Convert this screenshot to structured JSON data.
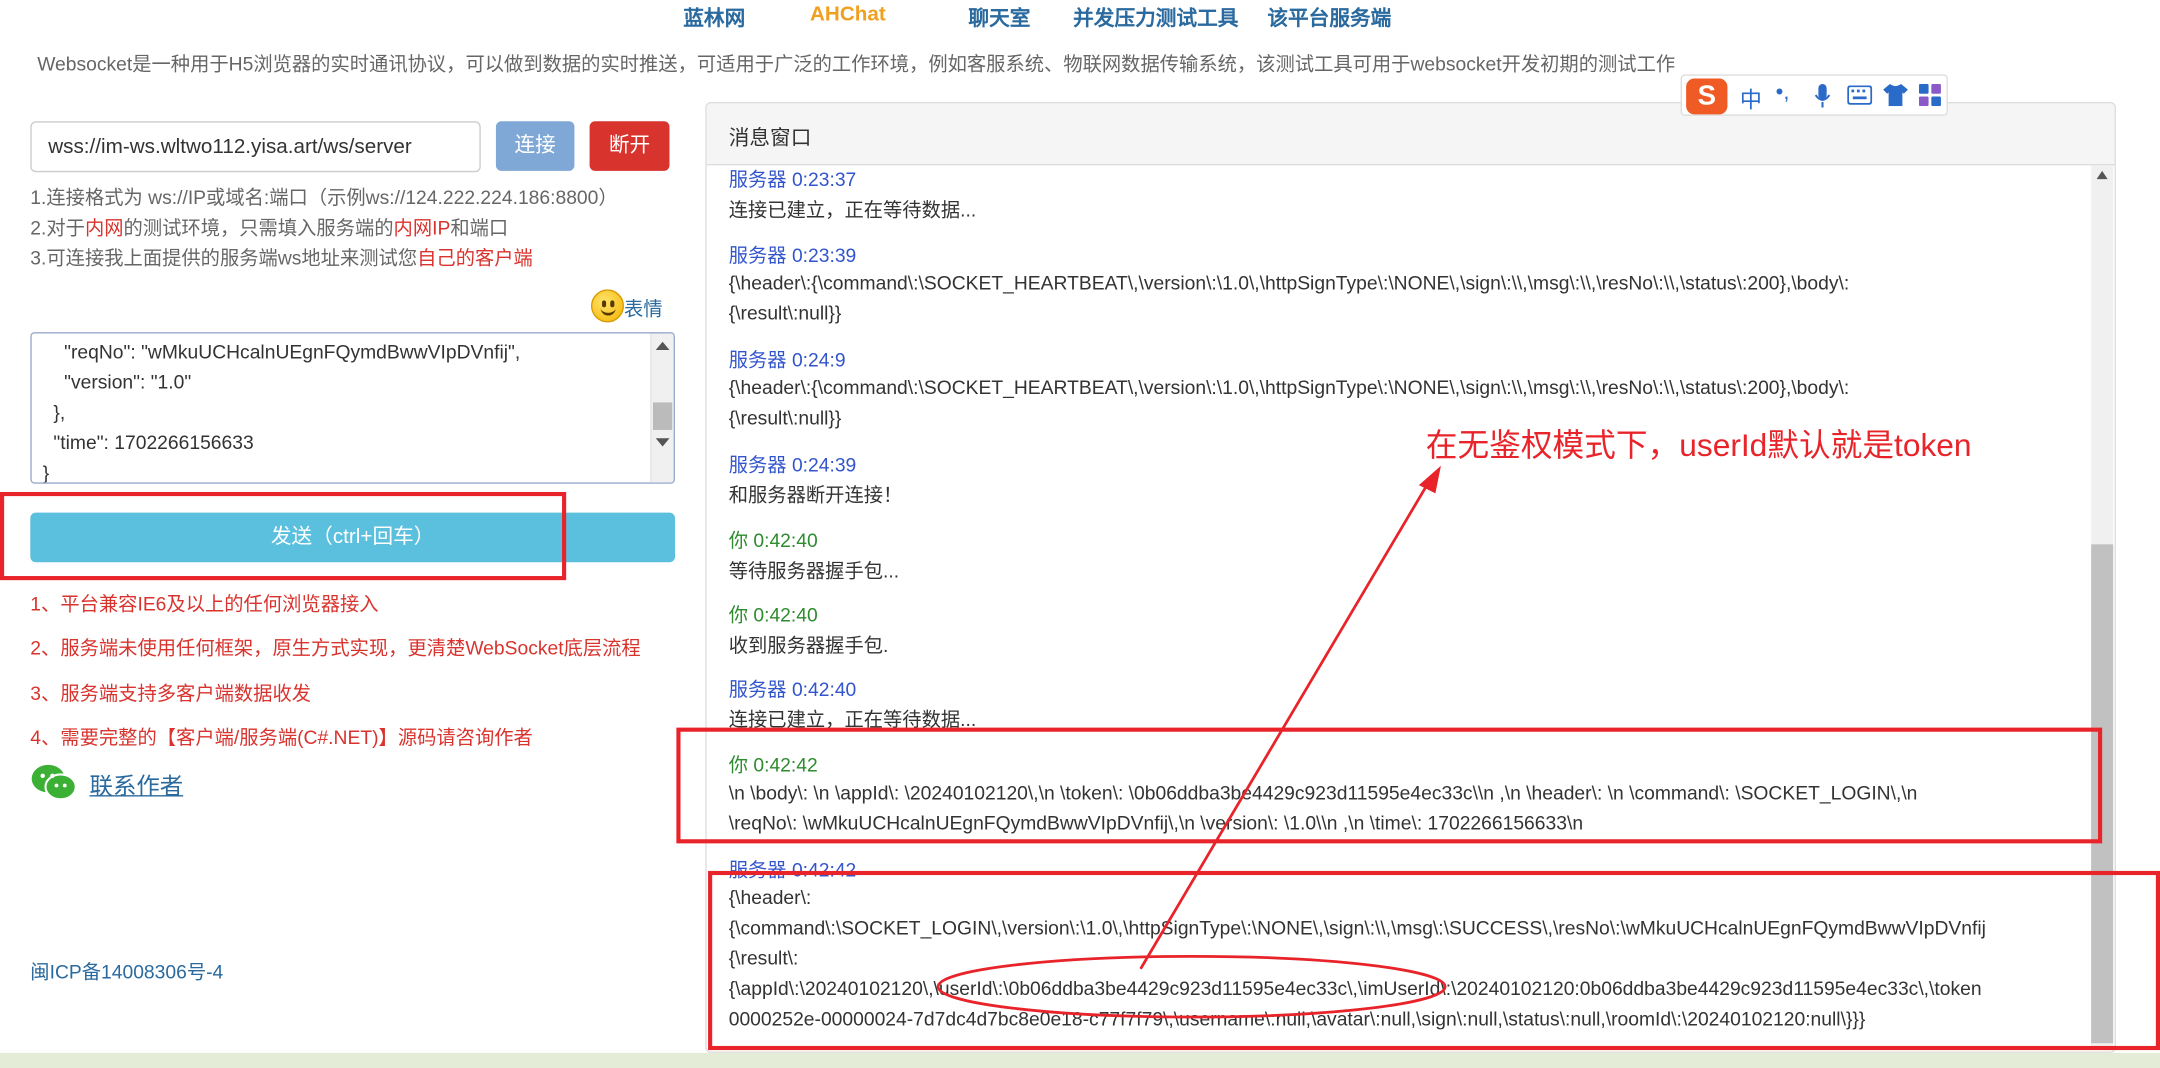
{
  "nav": {
    "items": [
      "蓝林网",
      "AHChat",
      "聊天室",
      "并发压力测试工具",
      "该平台服务端"
    ]
  },
  "description": "Websocket是一种用于H5浏览器的实时通讯协议，可以做到数据的实时推送，可适用于广泛的工作环境，例如客服系统、物联网数据传输系统，该测试工具可用于websocket开发初期的测试工作",
  "connection": {
    "url_value": "wss://im-ws.wltwo112.yisa.art/ws/server",
    "connect_label": "连接",
    "disconnect_label": "断开"
  },
  "notes": {
    "line1": "1.连接格式为 ws://IP或域名:端口（示例ws://124.222.224.186:8800）",
    "line2_pre": "2.对于",
    "line2_red1": "内网",
    "line2_mid": "的测试环境，只需填入服务端的",
    "line2_red2": "内网IP",
    "line2_post": "和端口",
    "line3_pre": "3.可连接我上面提供的服务端ws地址来测试您",
    "line3_red": "自己的客户端"
  },
  "emoji_label": "表情",
  "textarea": {
    "lines": [
      "    \"reqNo\": \"wMkuUCHcalnUEgnFQymdBwwVIpDVnfij\",",
      "    \"version\": \"1.0\"",
      "  },",
      "  \"time\": 1702266156633",
      "}"
    ]
  },
  "send_label": "发送（ctrl+回车）",
  "features": [
    "1、平台兼容IE6及以上的任何浏览器接入",
    "2、服务端未使用任何框架，原生方式实现，更清楚WebSocket底层流程",
    "3、服务端支持多客户端数据收发",
    "4、需要完整的【客户端/服务端(C#.NET)】源码请咨询作者"
  ],
  "contact_label": "联系作者",
  "icp": "闽ICP备14008306号-4",
  "panel_title": "消息窗口",
  "messages": [
    {
      "meta": "服务器 0:23:37",
      "lines": [
        "连接已建立，正在等待数据..."
      ]
    },
    {
      "meta": "服务器 0:23:39",
      "lines": [
        "{\\header\\:{\\command\\:\\SOCKET_HEARTBEAT\\,\\version\\:\\1.0\\,\\httpSignType\\:\\NONE\\,\\sign\\:\\\\,\\msg\\:\\\\,\\resNo\\:\\\\,\\status\\:200},\\body\\:",
        "{\\result\\:null}}"
      ]
    },
    {
      "meta": "服务器 0:24:9",
      "lines": [
        "{\\header\\:{\\command\\:\\SOCKET_HEARTBEAT\\,\\version\\:\\1.0\\,\\httpSignType\\:\\NONE\\,\\sign\\:\\\\,\\msg\\:\\\\,\\resNo\\:\\\\,\\status\\:200},\\body\\:",
        "{\\result\\:null}}"
      ]
    },
    {
      "meta": "服务器 0:24:39",
      "lines": [
        "和服务器断开连接！"
      ]
    },
    {
      "meta": "你 0:42:40",
      "lines": [
        "等待服务器握手包..."
      ]
    },
    {
      "meta": "你 0:42:40",
      "lines": [
        "收到服务器握手包."
      ]
    },
    {
      "meta": "服务器 0:42:40",
      "lines": [
        "连接已建立，正在等待数据..."
      ]
    },
    {
      "meta": "你 0:42:42",
      "lines": [
        "\\n \\body\\: \\n \\appId\\: \\20240102120\\,\\n \\token\\: \\0b06ddba3be4429c923d11595e4ec33c\\\\n ,\\n \\header\\: \\n \\command\\: \\SOCKET_LOGIN\\,\\n",
        "\\reqNo\\: \\wMkuUCHcalnUEgnFQymdBwwVIpDVnfij\\,\\n \\version\\: \\1.0\\\\n ,\\n \\time\\: 1702266156633\\n"
      ]
    },
    {
      "meta": "服务器 0:42:42",
      "lines": [
        "{\\header\\:",
        "{\\command\\:\\SOCKET_LOGIN\\,\\version\\:\\1.0\\,\\httpSignType\\:\\NONE\\,\\sign\\:\\\\,\\msg\\:\\SUCCESS\\,\\resNo\\:\\wMkuUCHcalnUEgnFQymdBwwVIpDVnfij",
        "{\\result\\:",
        "{\\appId\\:\\20240102120\\,\\userId\\:\\0b06ddba3be4429c923d11595e4ec33c\\,\\imUserId\\:\\20240102120:0b06ddba3be4429c923d11595e4ec33c\\,\\token",
        "0000252e-00000024-7d7dc4d7bc8e0e18-c77f7f79\\,\\username\\:null,\\avatar\\:null,\\sign\\:null,\\status\\:null,\\roomId\\:\\20240102120:null\\}}}"
      ]
    }
  ],
  "annotation": "在无鉴权模式下，userId默认就是token",
  "ime": {
    "labels": [
      "中",
      "•,"
    ]
  },
  "colors": {
    "accent_blue": "#2a6a9e",
    "connect_btn": "#7fa8d6",
    "disconnect_btn": "#d9332e",
    "send_btn": "#5bc0de",
    "annotation_red": "#e8242a"
  }
}
